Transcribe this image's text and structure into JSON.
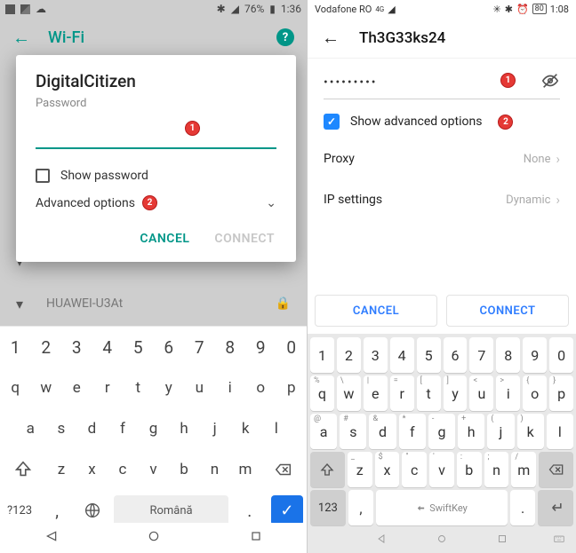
{
  "left": {
    "status": {
      "battery": "76%",
      "time": "1:36"
    },
    "topbar": {
      "title": "Wi-Fi",
      "help": "?"
    },
    "dialog": {
      "ssid": "DigitalCitizen",
      "password_label": "Password",
      "badges": {
        "pw": "1",
        "adv": "2"
      },
      "show_password": "Show password",
      "advanced": "Advanced options",
      "cancel": "CANCEL",
      "connect": "CONNECT"
    },
    "ghost_network": "HUAWEI-U3At",
    "keyboard": {
      "row_num": [
        "1",
        "2",
        "3",
        "4",
        "5",
        "6",
        "7",
        "8",
        "9",
        "0"
      ],
      "row_q": [
        "q",
        "w",
        "e",
        "r",
        "t",
        "y",
        "u",
        "i",
        "o",
        "p"
      ],
      "row_a": [
        "a",
        "s",
        "d",
        "f",
        "g",
        "h",
        "j",
        "k",
        "l"
      ],
      "row_z": [
        "z",
        "x",
        "c",
        "v",
        "b",
        "n",
        "m"
      ],
      "mode": "?123",
      "comma": ",",
      "period": ".",
      "space": "Română"
    }
  },
  "right": {
    "status": {
      "carrier": "Vodafone RO",
      "net": "4G",
      "battery": "80",
      "time": "1:08"
    },
    "topbar": {
      "title": "Th3G33ks24"
    },
    "password_masked": "•••••••••",
    "badges": {
      "pw": "1",
      "adv": "2"
    },
    "show_advanced": "Show advanced options",
    "options": {
      "proxy_label": "Proxy",
      "proxy_value": "None",
      "ip_label": "IP settings",
      "ip_value": "Dynamic"
    },
    "buttons": {
      "cancel": "CANCEL",
      "connect": "CONNECT"
    },
    "keyboard": {
      "row_num": [
        "1",
        "2",
        "3",
        "4",
        "5",
        "6",
        "7",
        "8",
        "9",
        "0"
      ],
      "row_q": [
        [
          "q",
          "%"
        ],
        [
          "w",
          "\\"
        ],
        [
          "e",
          "|"
        ],
        [
          "r",
          "="
        ],
        [
          "t",
          "["
        ],
        [
          "y",
          "]"
        ],
        [
          "u",
          "<"
        ],
        [
          "i",
          ">"
        ],
        [
          "o",
          "{"
        ],
        [
          "p",
          "}"
        ]
      ],
      "row_a": [
        [
          "a",
          "@"
        ],
        [
          "s",
          "#"
        ],
        [
          "d",
          "&"
        ],
        [
          "f",
          "*"
        ],
        [
          "g",
          "-"
        ],
        [
          "h",
          "+"
        ],
        [
          "j",
          "("
        ],
        [
          "k",
          ")"
        ],
        [
          "l",
          ""
        ]
      ],
      "row_z": [
        [
          "z",
          "_"
        ],
        [
          "x",
          "$"
        ],
        [
          "c",
          "\""
        ],
        [
          "v",
          "'"
        ],
        [
          "b",
          ":"
        ],
        [
          "n",
          ";"
        ],
        [
          "m",
          "/"
        ]
      ],
      "mode": "123",
      "comma": ",",
      "period": ".",
      "space": "SwiftKey"
    }
  }
}
